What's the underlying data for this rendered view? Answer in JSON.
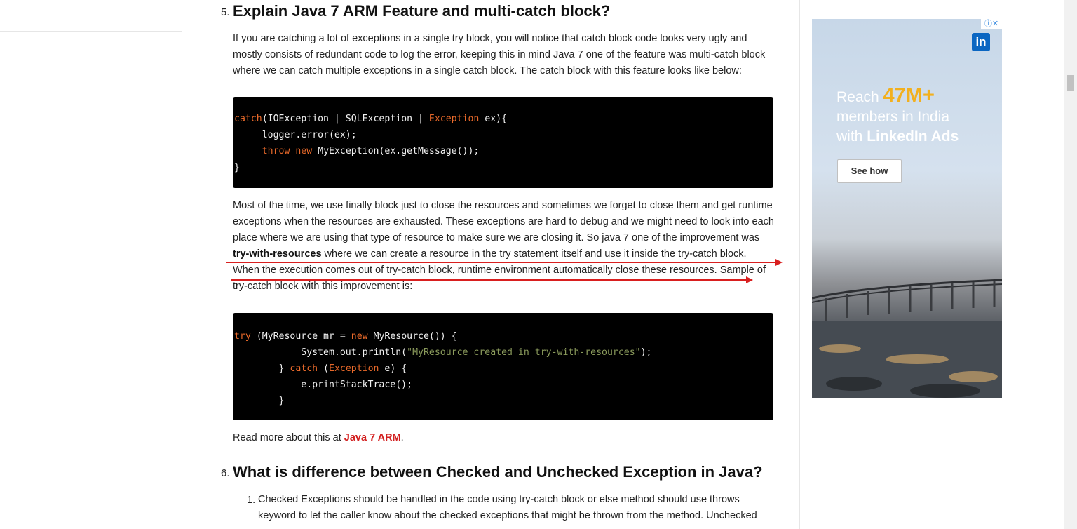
{
  "section5": {
    "number": "5.",
    "title": "Explain Java 7 ARM Feature and multi-catch block?",
    "para1": "If you are catching a lot of exceptions in a single try block, you will notice that catch block code looks very ugly and mostly consists of redundant code to log the error, keeping this in mind Java 7 one of the feature was multi-catch block where we can catch multiple exceptions in a single catch block. The catch block with this feature looks like below:",
    "code1": {
      "l1_kw1": "catch",
      "l1_a": "(IOException | SQLException | ",
      "l1_kw2": "Exception",
      "l1_b": " ex){",
      "l2": "     logger.error(ex);",
      "l3_indent": "     ",
      "l3_kw1": "throw",
      "l3_sp": " ",
      "l3_kw2": "new",
      "l3_rest": " MyException(ex.getMessage());",
      "l4": "}"
    },
    "para2_a": "Most of the time, we use finally block just to close the resources and sometimes we forget to close them and get runtime exceptions when the resources are exhausted. These exceptions are hard to debug and we might need to look into each place where we are using that type of resource to make sure we are closing it. So java 7 one of the improvement was ",
    "para2_bold": "try-with-resources",
    "para2_b": " where we can create a resource in the try statement itself and use it inside the try-catch block. When the execution comes out of try-catch block, runtime environment automatically close these resources. Sample of try-catch block with this improvement is:",
    "code2": {
      "l1_kw1": "try",
      "l1_a": " (MyResource mr = ",
      "l1_kw2": "new",
      "l1_b": " MyResource()) {",
      "l2_a": "            System.out.println(",
      "l2_str": "\"MyResource created in try-with-resources\"",
      "l2_b": ");",
      "l3_a": "        } ",
      "l3_kw1": "catch",
      "l3_b": " (",
      "l3_kw2": "Exception",
      "l3_c": " e) {",
      "l4": "            e.printStackTrace();",
      "l5": "        }"
    },
    "read_more_prefix": "Read more about this at ",
    "read_more_link": "Java 7 ARM",
    "read_more_suffix": "."
  },
  "section6": {
    "number": "6.",
    "title": "What is difference between Checked and Unchecked Exception in Java?",
    "item1_number": "1.",
    "item1_text": "Checked Exceptions should be handled in the code using try-catch block or else method should use throws keyword to let the caller know about the checked exceptions that might be thrown from the method. Unchecked"
  },
  "ad": {
    "adchoices": "ⓘ✕",
    "logo_text": "in",
    "reach": "Reach ",
    "members_count": "47M+",
    "line2": "members in India",
    "line3_pre": "with ",
    "line3_bold": "LinkedIn Ads",
    "cta": "See how"
  },
  "colors": {
    "annotation_arrow": "#d91f1f",
    "link": "#d32020",
    "code_keyword": "#e8692a",
    "code_string": "#8a9a5b"
  }
}
